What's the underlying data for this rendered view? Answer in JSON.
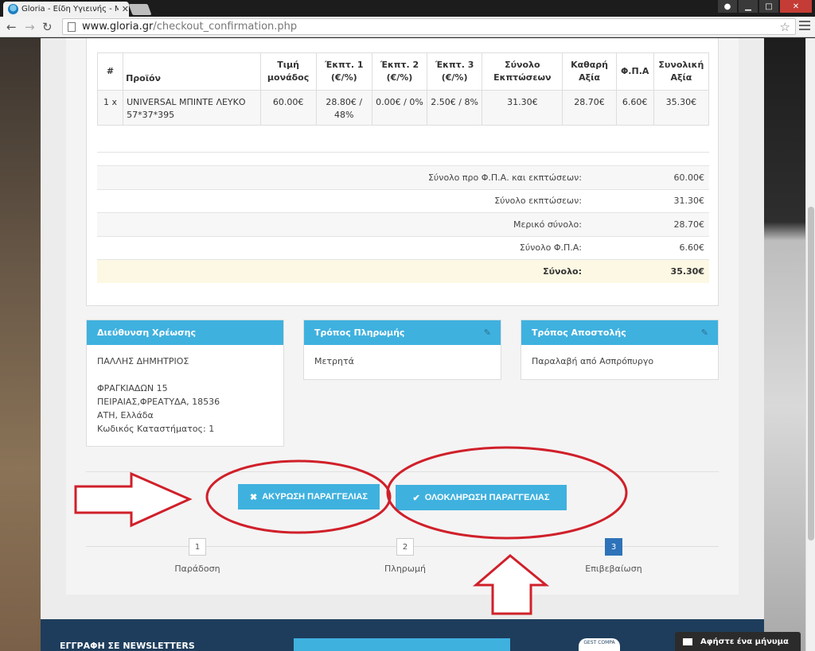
{
  "browser": {
    "tab_title": "Gloria - Είδη Υγιεινής - Μπ",
    "url_host": "www.gloria.gr",
    "url_path": "/checkout_confirmation.php"
  },
  "items_table": {
    "headers": [
      "#",
      "Προϊόν",
      "Τιμή μονάδος",
      "Έκπτ. 1 (€/%)",
      "Έκπτ. 2 (€/%)",
      "Έκπτ. 3 (€/%)",
      "Σύνολο Εκπτώσεων",
      "Καθαρή Αξία",
      "Φ.Π.Α",
      "Συνολική Αξία"
    ],
    "rows": [
      [
        "1 x",
        "UNIVERSAL ΜΠΙΝΤΕ ΛΕΥΚΟ 57*37*395",
        "60.00€",
        "28.80€ / 48%",
        "0.00€ / 0%",
        "2.50€ / 8%",
        "31.30€",
        "28.70€",
        "6.60€",
        "35.30€"
      ]
    ]
  },
  "summary": [
    {
      "label": "Σύνολο προ Φ.Π.Α. και εκπτώσεων:",
      "value": "60.00€"
    },
    {
      "label": "Σύνολο εκπτώσεων:",
      "value": "31.30€"
    },
    {
      "label": "Μερικό σύνολο:",
      "value": "28.70€"
    },
    {
      "label": "Σύνολο Φ.Π.Α:",
      "value": "6.60€"
    },
    {
      "label": "Σύνολο:",
      "value": "35.30€"
    }
  ],
  "billing": {
    "title": "Διεύθυνση Χρέωσης",
    "name": "ΠΑΛΛΗΣ ΔΗΜΗΤΡΙΟΣ",
    "street": "ΦΡΑΓΚΙΑΔΩΝ 15",
    "city": "ΠΕΙΡΑΙΑΣ,ΦΡΕΑΤΥΔΑ, 18536",
    "region": "ΑΤΗ, Ελλάδα",
    "store_code": "Κωδικός Καταστήματος: 1"
  },
  "payment": {
    "title": "Τρόπος Πληρωμής",
    "value": "Μετρητά"
  },
  "shipping": {
    "title": "Τρόπος Αποστολής",
    "value": "Παραλαβή από Ασπρόπυργο"
  },
  "actions": {
    "cancel_label": "ΑΚΥΡΩΣΗ ΠΑΡΑΓΓΕΛΙΑΣ",
    "complete_label": "ΟΛΟΚΛΗΡΩΣΗ ΠΑΡΑΓΓΕΛΙΑΣ"
  },
  "steps": [
    {
      "number": "1",
      "label": "Παράδοση"
    },
    {
      "number": "2",
      "label": "Πληρωμή"
    },
    {
      "number": "3",
      "label": "Επιβεβαίωση"
    }
  ],
  "footer": {
    "newsletter_title": "ΕΓΓΡΑΦΗ ΣΕ NEWSLETTERS",
    "logo_text": "GEST COMPA",
    "chat_label": "Αφήστε ένα μήνυμα"
  },
  "colors": {
    "accent": "#3fb1df",
    "step_active": "#2e73b9",
    "total_row": "#fcf8e3",
    "annotation_red": "#d0202a",
    "footer_bg": "#1e3d5c"
  }
}
